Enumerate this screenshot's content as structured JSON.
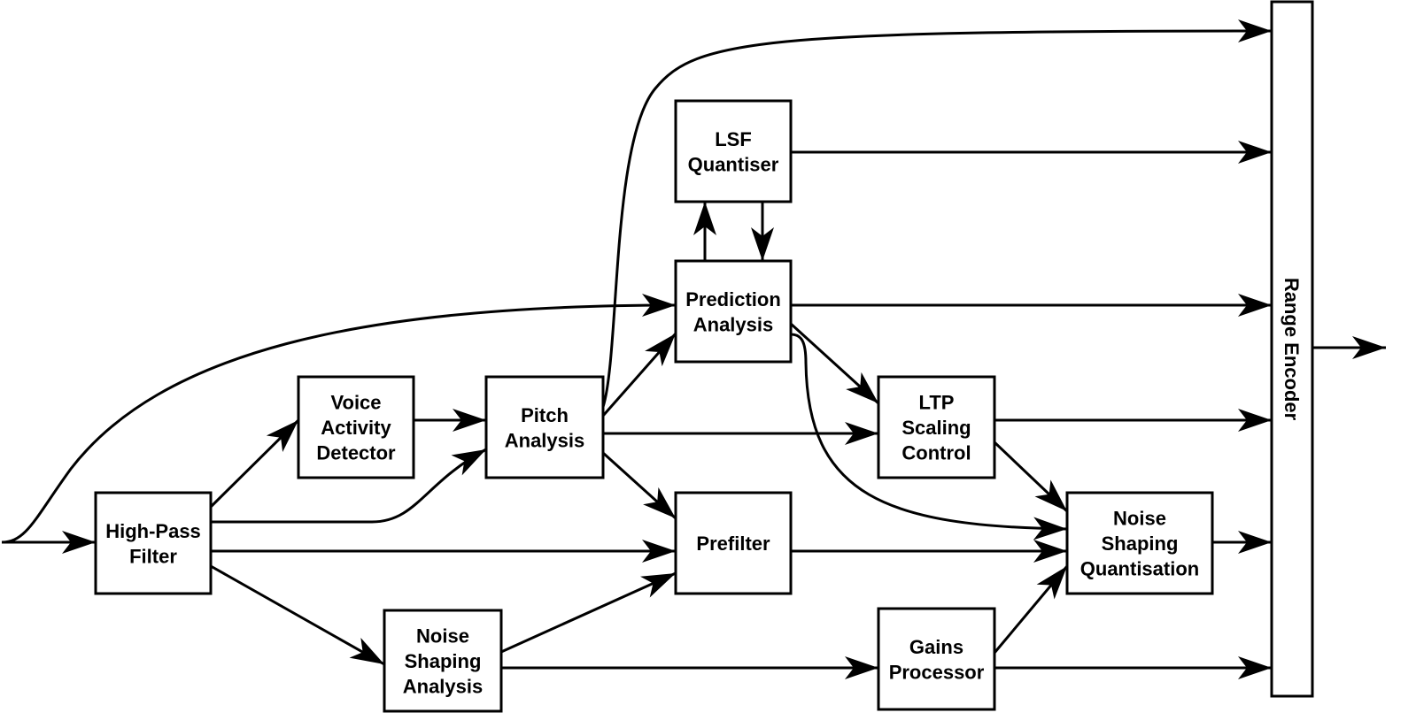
{
  "colors": {
    "stroke": "#000000",
    "background": "#ffffff"
  },
  "blocks": {
    "hpf": [
      "High-Pass",
      "Filter"
    ],
    "vad": [
      "Voice",
      "Activity",
      "Detector"
    ],
    "pitch": [
      "Pitch",
      "Analysis"
    ],
    "lsf": [
      "LSF",
      "Quantiser"
    ],
    "pred": [
      "Prediction",
      "Analysis"
    ],
    "prefilter": [
      "Prefilter"
    ],
    "nsa": [
      "Noise",
      "Shaping",
      "Analysis"
    ],
    "ltp": [
      "LTP",
      "Scaling",
      "Control"
    ],
    "gains": [
      "Gains",
      "Processor"
    ],
    "nsq": [
      "Noise",
      "Shaping",
      "Quantisation"
    ],
    "range": [
      "Range Encoder"
    ]
  }
}
